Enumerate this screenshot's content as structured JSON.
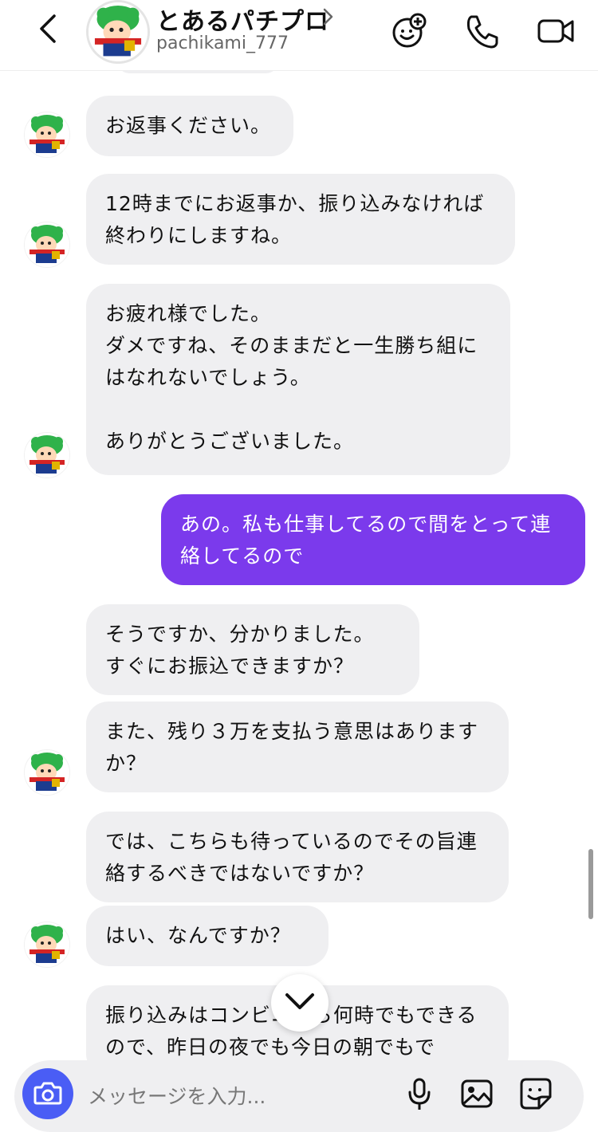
{
  "header": {
    "title": "とあるパチプロ",
    "username": "pachikami_777"
  },
  "icons": {
    "back": "chevron-left-icon",
    "title_chevron": "chevron-right-icon",
    "add_friend": "smiley-plus-icon",
    "call": "phone-icon",
    "video": "video-camera-icon",
    "jump_down": "chevron-down-icon",
    "camera": "camera-icon",
    "mic": "microphone-icon",
    "gallery": "image-icon",
    "sticker": "sticker-icon"
  },
  "colors": {
    "sent_bubble": "#7b3aec",
    "received_bubble": "#efeff1",
    "camera_button": "#4a5df5"
  },
  "messages": [
    {
      "sender": "them",
      "text": "お返事ください。"
    },
    {
      "sender": "them",
      "text": "12時までにお返事か、振り込みなければ終わりにしますね。"
    },
    {
      "sender": "them",
      "text": "お疲れ様でした。\nダメですね、そのままだと一生勝ち組にはなれないでしょう。\n\nありがとうございました。"
    },
    {
      "sender": "me",
      "text": "あの。私も仕事してるので間をとって連絡してるので"
    },
    {
      "sender": "them",
      "text": "そうですか、分かりました。\nすぐにお振込できますか？"
    },
    {
      "sender": "them",
      "text": "また、残り３万を支払う意思はありますか？"
    },
    {
      "sender": "them",
      "text": "では、こちらも待っているのでその旨連絡するべきではないですか？"
    },
    {
      "sender": "them",
      "text": "はい、なんですか？"
    },
    {
      "sender": "them",
      "text": "振り込みはコンビニから何時でもできるので、昨日の夜でも今日の朝でもで"
    }
  ],
  "composer": {
    "placeholder": "メッセージを入力..."
  }
}
